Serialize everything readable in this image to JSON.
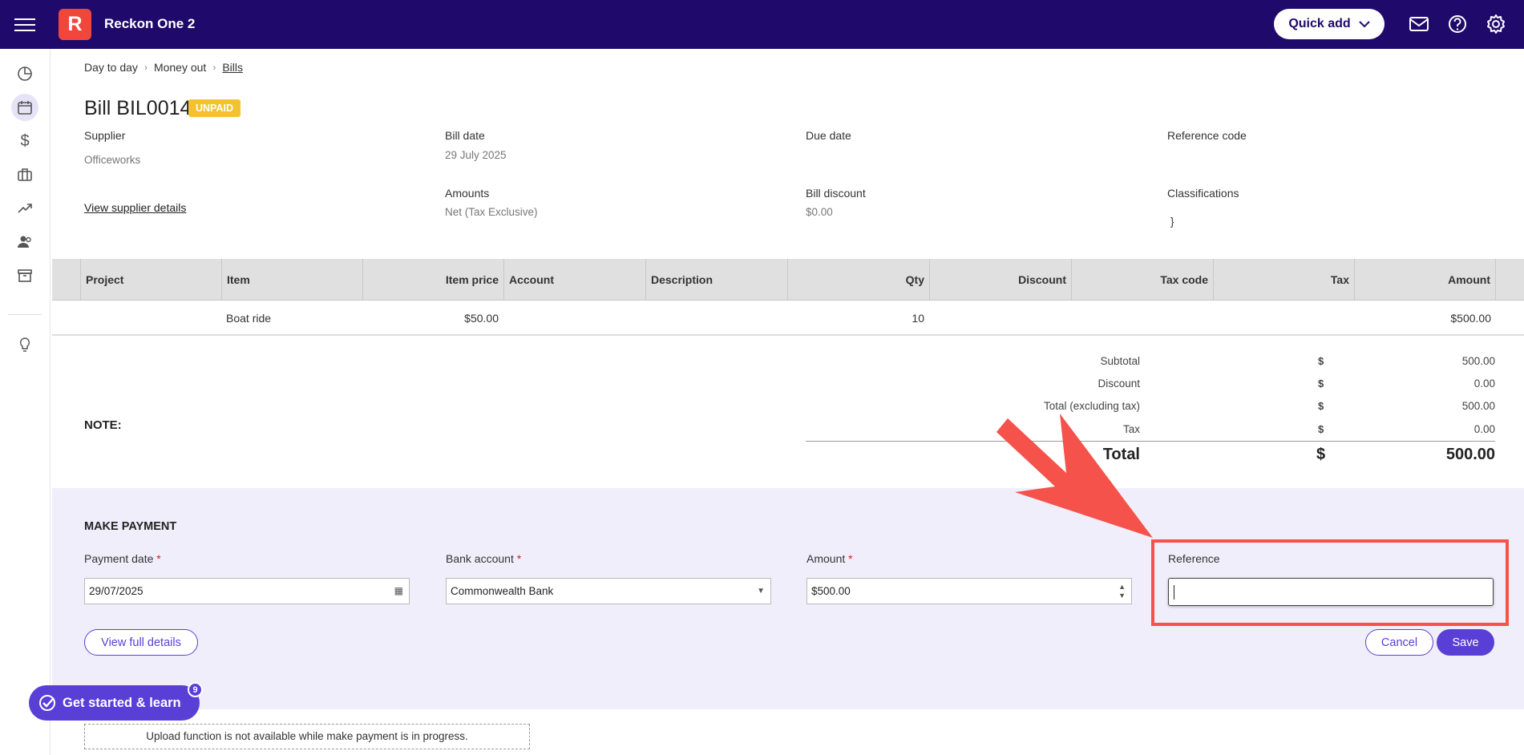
{
  "app": {
    "title": "Reckon One 2",
    "logo_letter": "R"
  },
  "topbar": {
    "quick_add_label": "Quick add"
  },
  "breadcrumb": [
    "Day to day",
    "Money out",
    "Bills"
  ],
  "bill": {
    "title": "Bill BIL0014",
    "status": "UNPAID",
    "supplier_label": "Supplier",
    "supplier_value": "Officeworks",
    "view_supplier_link": "View supplier details",
    "bill_date_label": "Bill date",
    "bill_date_value": "29 July 2025",
    "due_date_label": "Due date",
    "reference_code_label": "Reference code",
    "amounts_label": "Amounts",
    "amounts_value": "Net (Tax Exclusive)",
    "bill_discount_label": "Bill discount",
    "bill_discount_value": "$0.00",
    "classifications_label": "Classifications",
    "classifications_value": "}"
  },
  "table": {
    "headers": [
      "Project",
      "Item",
      "Item price",
      "Account",
      "Description",
      "Qty",
      "Discount",
      "Tax code",
      "Tax",
      "Amount"
    ],
    "rows": [
      {
        "project": "",
        "item": "Boat ride",
        "item_price": "$50.00",
        "account": "",
        "description": "",
        "qty": "10",
        "discount": "",
        "tax_code": "",
        "tax": "",
        "amount": "$500.00"
      }
    ]
  },
  "totals": {
    "currency": "$",
    "subtotal_label": "Subtotal",
    "subtotal_value": "500.00",
    "discount_label": "Discount",
    "discount_value": "0.00",
    "total_ex_label": "Total (excluding tax)",
    "total_ex_value": "500.00",
    "tax_label": "Tax",
    "tax_value": "0.00",
    "total_label": "Total",
    "total_value": "500.00"
  },
  "note_label": "NOTE:",
  "payment": {
    "title": "MAKE PAYMENT",
    "payment_date_label": "Payment date",
    "payment_date_value": "29/07/2025",
    "bank_account_label": "Bank account",
    "bank_account_value": "Commonwealth Bank",
    "amount_label": "Amount",
    "amount_value": "$500.00",
    "reference_label": "Reference",
    "reference_value": "",
    "view_full_details": "View full details",
    "cancel": "Cancel",
    "save": "Save",
    "required_mark": "*"
  },
  "get_started": {
    "label": "Get started & learn",
    "count": "9"
  },
  "upload_note": "Upload function is not available while make payment is in progress.",
  "colors": {
    "topbar": "#1f0a6b",
    "accent": "#5a3fd6",
    "badge": "#f2c230",
    "annotation": "#f4524a"
  }
}
